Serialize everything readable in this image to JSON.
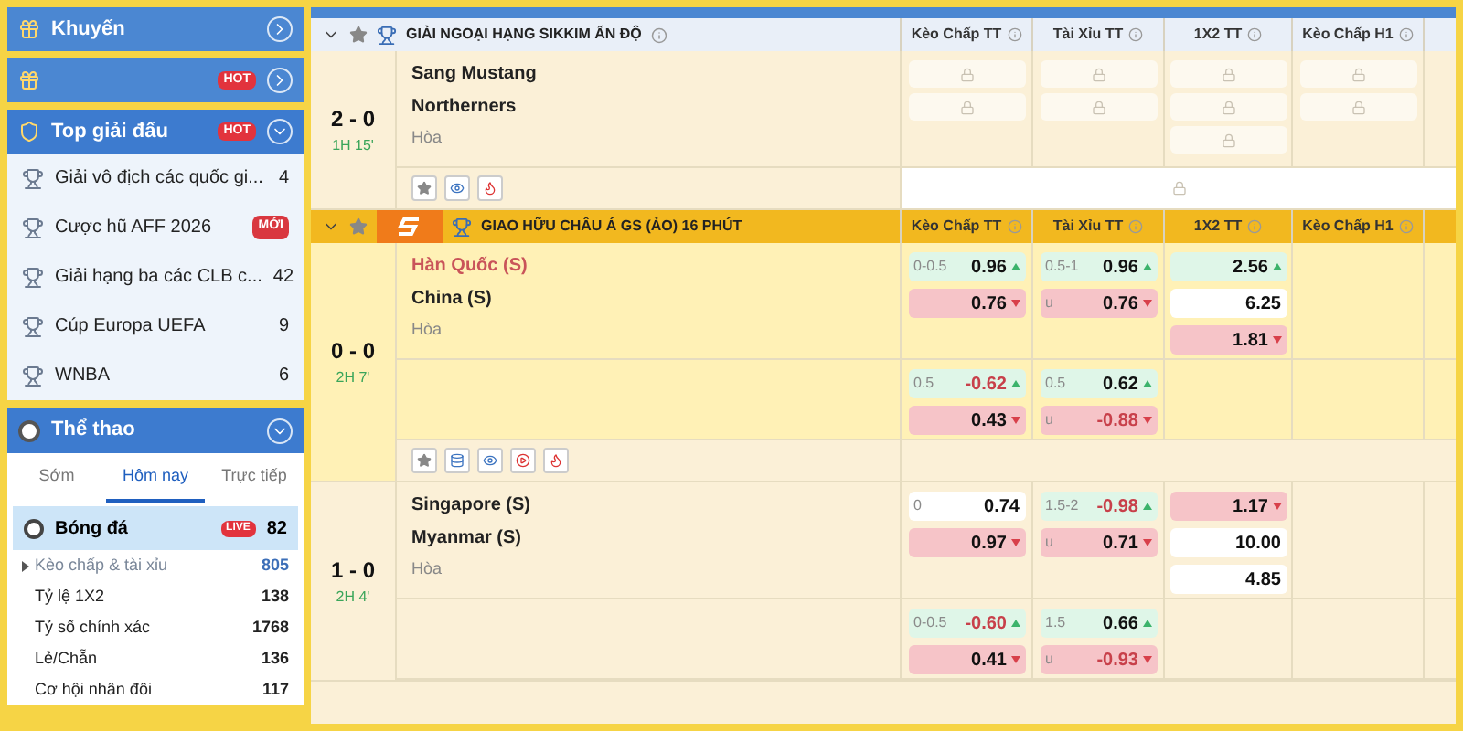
{
  "sidebar": {
    "promo_panels": [
      {
        "title": "Khuyến",
        "expanded": false
      },
      {
        "badge": "HOT",
        "expanded": false
      }
    ],
    "top_leagues": {
      "title": "Top giải đấu",
      "badge": "HOT",
      "expanded": true,
      "items": [
        {
          "name": "Giải vô địch các quốc gi...",
          "count": "4"
        },
        {
          "name": "Cược hũ AFF 2026",
          "badge": "MỚI"
        },
        {
          "name": "Giải hạng ba các CLB c...",
          "count": "42"
        },
        {
          "name": "Cúp Europa UEFA",
          "count": "9"
        },
        {
          "name": "WNBA",
          "count": "6"
        }
      ]
    },
    "sports": {
      "title": "Thể thao",
      "expanded": true,
      "tabs": [
        {
          "label": "Sớm",
          "selected": false
        },
        {
          "label": "Hôm nay",
          "selected": true
        },
        {
          "label": "Trực tiếp",
          "selected": false
        }
      ],
      "sport": {
        "name": "Bóng đá",
        "badge": "LIVE",
        "count": "82",
        "selected": true
      },
      "markets": [
        {
          "name": "Kèo chấp & tài xỉu",
          "count": "805",
          "selected": true
        },
        {
          "name": "Tỷ lệ 1X2",
          "count": "138",
          "selected": false
        },
        {
          "name": "Tỷ số chính xác",
          "count": "1768",
          "selected": false
        },
        {
          "name": "Lẻ/Chẵn",
          "count": "136",
          "selected": false
        },
        {
          "name": "Cơ hội nhân đôi",
          "count": "117",
          "selected": false
        }
      ]
    }
  },
  "leagues": [
    {
      "title": "GIẢI NGOẠI HẠNG SIKKIM ẤN ĐỘ",
      "kind": "standard",
      "columns": [
        "Kèo Chấp TT",
        "Tài Xỉu TT",
        "1X2 TT",
        "Kèo Chấp H1"
      ],
      "matches": [
        {
          "score": "2 - 0",
          "time": "1H 15'",
          "home": "Sang Mustang",
          "away": "Northerners",
          "draw": "Hòa",
          "home_favorite": false,
          "locked": true,
          "stats_available": false,
          "video_available": false
        }
      ]
    },
    {
      "title": "GIAO HỮU CHÂU Á GS (ẢO) 16 PHÚT",
      "kind": "virtual",
      "columns": [
        "Kèo Chấp TT",
        "Tài Xỉu TT",
        "1X2 TT",
        "Kèo Chấp H1"
      ],
      "matches": [
        {
          "score": "0 - 0",
          "time": "2H 7'",
          "home": "Hàn Quốc (S)",
          "away": "China (S)",
          "draw": "Hòa",
          "home_favorite": true,
          "locked": false,
          "stats_available": true,
          "video_available": true,
          "lines": [
            {
              "handicap": [
                {
                  "line": "0-0.5",
                  "odds": "0.96",
                  "up": true,
                  "down": false,
                  "negative": false
                },
                {
                  "odds": "0.76",
                  "up": false,
                  "down": true,
                  "negative": false
                }
              ],
              "over_under": [
                {
                  "line": "0.5-1",
                  "odds": "0.96",
                  "up": true,
                  "down": false,
                  "negative": false
                },
                {
                  "line": "u",
                  "odds": "0.76",
                  "up": false,
                  "down": true,
                  "negative": false
                }
              ],
              "x12": [
                {
                  "odds": "2.56",
                  "up": true,
                  "down": false,
                  "negative": false
                },
                {
                  "odds": "6.25",
                  "up": false,
                  "down": false,
                  "negative": false
                },
                {
                  "odds": "1.81",
                  "up": false,
                  "down": true,
                  "negative": false
                }
              ]
            },
            {
              "handicap": [
                {
                  "line": "0.5",
                  "odds": "-0.62",
                  "up": true,
                  "down": false,
                  "negative": true
                },
                {
                  "odds": "0.43",
                  "up": false,
                  "down": true,
                  "negative": false
                }
              ],
              "over_under": [
                {
                  "line": "0.5",
                  "odds": "0.62",
                  "up": true,
                  "down": false,
                  "negative": false
                },
                {
                  "line": "u",
                  "odds": "-0.88",
                  "up": false,
                  "down": true,
                  "negative": true
                }
              ]
            }
          ]
        },
        {
          "score": "1 - 0",
          "time": "2H 4'",
          "home": "Singapore (S)",
          "away": "Myanmar (S)",
          "draw": "Hòa",
          "home_favorite": false,
          "locked": false,
          "lines": [
            {
              "handicap": [
                {
                  "line": "0",
                  "odds": "0.74",
                  "up": false,
                  "down": false,
                  "negative": false
                },
                {
                  "odds": "0.97",
                  "up": false,
                  "down": true,
                  "negative": false
                }
              ],
              "over_under": [
                {
                  "line": "1.5-2",
                  "odds": "-0.98",
                  "up": true,
                  "down": false,
                  "negative": true
                },
                {
                  "line": "u",
                  "odds": "0.71",
                  "up": false,
                  "down": true,
                  "negative": false
                }
              ],
              "x12": [
                {
                  "odds": "1.17",
                  "up": false,
                  "down": true,
                  "negative": false
                },
                {
                  "odds": "10.00",
                  "up": false,
                  "down": false,
                  "negative": false
                },
                {
                  "odds": "4.85",
                  "up": false,
                  "down": false,
                  "negative": false
                }
              ]
            },
            {
              "handicap": [
                {
                  "line": "0-0.5",
                  "odds": "-0.60",
                  "up": true,
                  "down": false,
                  "negative": true
                },
                {
                  "odds": "0.41",
                  "up": false,
                  "down": true,
                  "negative": false
                }
              ],
              "over_under": [
                {
                  "line": "1.5",
                  "odds": "0.66",
                  "up": true,
                  "down": false,
                  "negative": false
                },
                {
                  "line": "u",
                  "odds": "-0.93",
                  "up": false,
                  "down": true,
                  "negative": true
                }
              ]
            }
          ]
        }
      ]
    }
  ]
}
